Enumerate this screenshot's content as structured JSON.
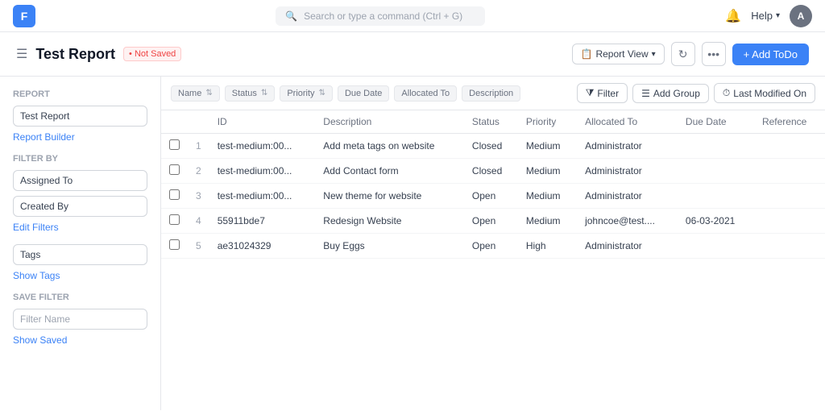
{
  "app": {
    "icon": "F",
    "search_placeholder": "Search or type a command (Ctrl + G)"
  },
  "nav": {
    "help_label": "Help",
    "avatar_label": "A"
  },
  "header": {
    "title": "Test Report",
    "not_saved": "• Not Saved",
    "report_view_label": "Report View",
    "add_todo_label": "+ Add ToDo"
  },
  "sidebar": {
    "report_section_label": "Report",
    "report_select_value": "Test Report",
    "report_builder_link": "Report Builder",
    "filter_by_label": "Filter By",
    "filter_select_1": "Assigned To",
    "filter_select_2": "Created By",
    "edit_filters_link": "Edit Filters",
    "tags_label": "Tags",
    "show_tags_link": "Show Tags",
    "save_filter_label": "Save Filter",
    "filter_name_placeholder": "Filter Name",
    "show_saved_link": "Show Saved"
  },
  "col_header_bar": {
    "tags": [
      "Name",
      "Status",
      "Priority",
      "Due Date",
      "Allocated To",
      "Description"
    ],
    "filter_label": "Filter",
    "add_group_label": "Add Group",
    "last_modified_label": "Last Modified On"
  },
  "table": {
    "columns": [
      "",
      "",
      "ID",
      "Description",
      "Status",
      "Priority",
      "Allocated To",
      "Due Date",
      "Reference"
    ],
    "rows": [
      {
        "num": 1,
        "id": "test-medium:00...",
        "description": "Add meta tags on website",
        "status": "Closed",
        "priority": "Medium",
        "allocated_to": "Administrator",
        "due_date": "",
        "reference": ""
      },
      {
        "num": 2,
        "id": "test-medium:00...",
        "description": "Add Contact form",
        "status": "Closed",
        "priority": "Medium",
        "allocated_to": "Administrator",
        "due_date": "",
        "reference": ""
      },
      {
        "num": 3,
        "id": "test-medium:00...",
        "description": "New theme for website",
        "status": "Open",
        "priority": "Medium",
        "allocated_to": "Administrator",
        "due_date": "",
        "reference": ""
      },
      {
        "num": 4,
        "id": "55911bde7",
        "description": "Redesign Website",
        "status": "Open",
        "priority": "Medium",
        "allocated_to": "johncoe@test....",
        "due_date": "06-03-2021",
        "reference": ""
      },
      {
        "num": 5,
        "id": "ae31024329",
        "description": "Buy Eggs",
        "status": "Open",
        "priority": "High",
        "allocated_to": "Administrator",
        "due_date": "",
        "reference": ""
      }
    ]
  }
}
